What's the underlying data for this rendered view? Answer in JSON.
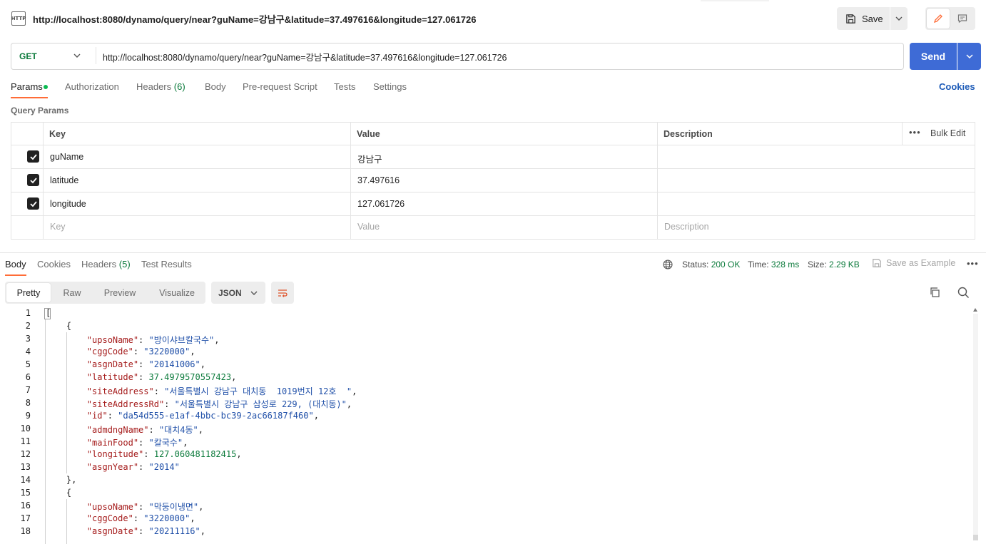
{
  "title_bar": {
    "icon_text": "HTTP",
    "request_title": "http://localhost:8080/dynamo/query/near?guName=강남구&latitude=37.497616&longitude=127.061726",
    "save_label": "Save"
  },
  "url_bar": {
    "method": "GET",
    "url": "http://localhost:8080/dynamo/query/near?guName=강남구&latitude=37.497616&longitude=127.061726",
    "send_label": "Send"
  },
  "request_tabs": {
    "params": "Params",
    "authorization": "Authorization",
    "headers": "Headers",
    "headers_count": "(6)",
    "body": "Body",
    "prerequest": "Pre-request Script",
    "tests": "Tests",
    "settings": "Settings",
    "cookies": "Cookies"
  },
  "query_params": {
    "label": "Query Params",
    "columns": {
      "key": "Key",
      "value": "Value",
      "description": "Description"
    },
    "bulk_edit": "Bulk Edit",
    "rows": [
      {
        "key": "guName",
        "value": "강남구"
      },
      {
        "key": "latitude",
        "value": "37.497616"
      },
      {
        "key": "longitude",
        "value": "127.061726"
      }
    ],
    "placeholder": {
      "key": "Key",
      "value": "Value",
      "description": "Description"
    }
  },
  "response_tabs": {
    "body": "Body",
    "cookies": "Cookies",
    "headers": "Headers",
    "headers_count": "(5)",
    "test_results": "Test Results"
  },
  "response_meta": {
    "status_label": "Status:",
    "status_value": "200 OK",
    "time_label": "Time:",
    "time_value": "328 ms",
    "size_label": "Size:",
    "size_value": "2.29 KB",
    "save_example": "Save as Example"
  },
  "response_toolbar": {
    "pretty": "Pretty",
    "raw": "Raw",
    "preview": "Preview",
    "visualize": "Visualize",
    "language": "JSON"
  },
  "code": {
    "line_numbers": [
      "1",
      "2",
      "3",
      "4",
      "5",
      "6",
      "7",
      "8",
      "9",
      "10",
      "11",
      "12",
      "13",
      "14",
      "15",
      "16",
      "17",
      "18"
    ],
    "l3_key": "\"upsoName\"",
    "l3_val": "\"방이샤브칼국수\"",
    "l4_key": "\"cggCode\"",
    "l4_val": "\"3220000\"",
    "l5_key": "\"asgnDate\"",
    "l5_val": "\"20141006\"",
    "l6_key": "\"latitude\"",
    "l6_val": "37.4979570557423",
    "l7_key": "\"siteAddress\"",
    "l7_val": "\"서울특별시 강남구 대치동  1019번지 12호  \"",
    "l8_key": "\"siteAddressRd\"",
    "l8_val": "\"서울특별시 강남구 삼성로 229, (대치동)\"",
    "l9_key": "\"id\"",
    "l9_val": "\"da54d555-e1af-4bbc-bc39-2ac66187f460\"",
    "l10_key": "\"admdngName\"",
    "l10_val": "\"대치4동\"",
    "l11_key": "\"mainFood\"",
    "l11_val": "\"칼국수\"",
    "l12_key": "\"longitude\"",
    "l12_val": "127.060481182415",
    "l13_key": "\"asgnYear\"",
    "l13_val": "\"2014\"",
    "l16_key": "\"upsoName\"",
    "l16_val": "\"막둥이냉면\"",
    "l17_key": "\"cggCode\"",
    "l17_val": "\"3220000\"",
    "l18_key": "\"asgnDate\"",
    "l18_val": "\"20211116\""
  },
  "colors": {
    "accent_orange": "#ff6c37",
    "send_blue": "#3e6bd6",
    "status_green": "#0b7a3b"
  },
  "icons": [
    "http-icon",
    "save-icon",
    "chevron-down-icon",
    "pencil-icon",
    "comment-icon",
    "checkbox-checked-icon",
    "more-icon",
    "globe-icon",
    "save-example-icon",
    "wrap-lines-icon",
    "copy-icon",
    "search-icon"
  ]
}
